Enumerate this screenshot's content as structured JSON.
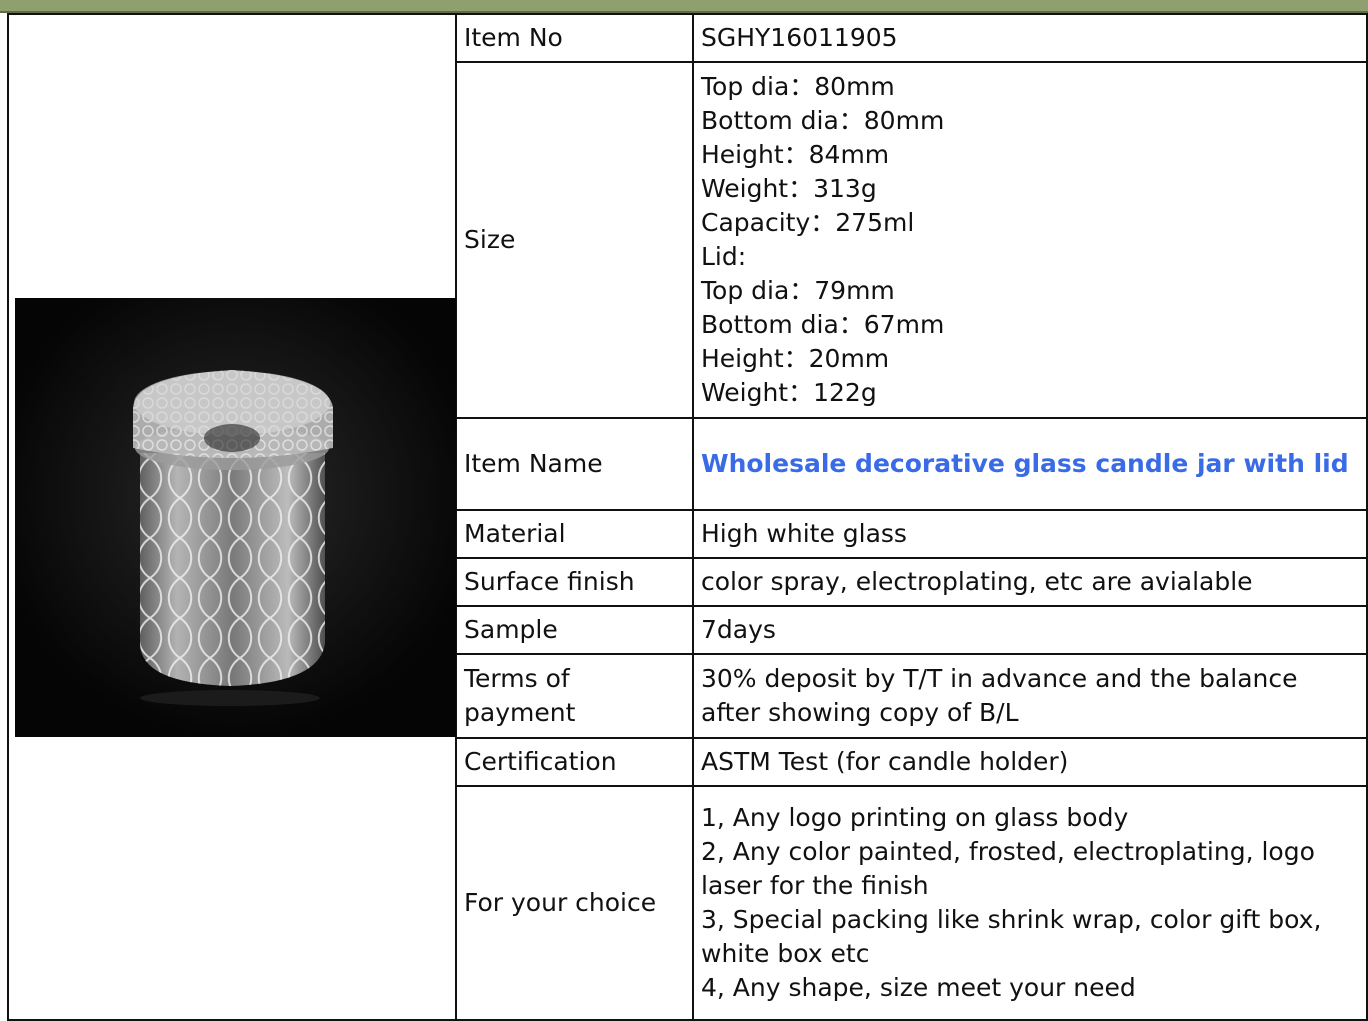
{
  "product_image_alt": "decorative glass candle jar with lid",
  "specs": {
    "item_no": {
      "label": "Item No",
      "value": "SGHY16011905"
    },
    "size": {
      "label": "Size",
      "lines": [
        "Top dia：80mm",
        "Bottom dia：80mm",
        "Height：84mm",
        "Weight：313g",
        "Capacity：275ml",
        "Lid:",
        "Top dia：79mm",
        "Bottom dia：67mm",
        "Height：20mm",
        "Weight：122g"
      ]
    },
    "item_name": {
      "label": "Item Name",
      "value": "Wholesale decorative glass candle jar with lid",
      "link_color": "#3a6be6"
    },
    "material": {
      "label": "Material",
      "value": "High white glass"
    },
    "surface_finish": {
      "label": "Surface finish",
      "value": "color spray, electroplating, etc are avialable"
    },
    "sample": {
      "label": "Sample",
      "value": "7days"
    },
    "terms": {
      "label": "Terms of payment",
      "value": "30% deposit by T/T in advance and the balance after showing copy of B/L"
    },
    "certification": {
      "label": "Certification",
      "value": "ASTM Test (for candle holder)"
    },
    "choice": {
      "label": "For your choice",
      "lines": [
        "1, Any logo printing on glass body",
        "2, Any color painted, frosted, electroplating, logo laser for the finish",
        "3, Special packing like shrink wrap, color gift box, white box etc",
        "4, Any shape, size meet your need"
      ]
    }
  },
  "colors": {
    "header_strip": "#8f9f6e",
    "border": "#111111",
    "photo_bg": "#050505"
  }
}
